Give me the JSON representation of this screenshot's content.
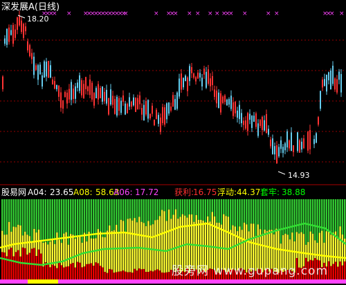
{
  "chart_title": "深发展A(日线)",
  "price_high_label": "18.20",
  "price_low_label": "14.93",
  "indicator": {
    "name": "股易网",
    "items": [
      {
        "label": "A04:",
        "value": "23.65",
        "color": "#ffffff"
      },
      {
        "label": "A08:",
        "value": "58.63",
        "color": "#ffff00"
      },
      {
        "label": "A06:",
        "value": "17.72",
        "color": "#ff44ff"
      },
      {
        "label": "获利:",
        "value": "16.75",
        "color": "#ff3030"
      },
      {
        "label": "浮动:",
        "value": "44.37",
        "color": "#ffff00"
      },
      {
        "label": "套牢:",
        "value": "38.88",
        "color": "#00ff00"
      }
    ]
  },
  "watermark": "股旁网 www.gupang.com",
  "colors": {
    "up": "#ff3333",
    "down": "#66ccee",
    "grid": "#990000",
    "marker": "#ff44ff",
    "bar_green": "#33cc33",
    "bar_yellow": "#ffff33",
    "bar_red": "#ee0000"
  }
}
